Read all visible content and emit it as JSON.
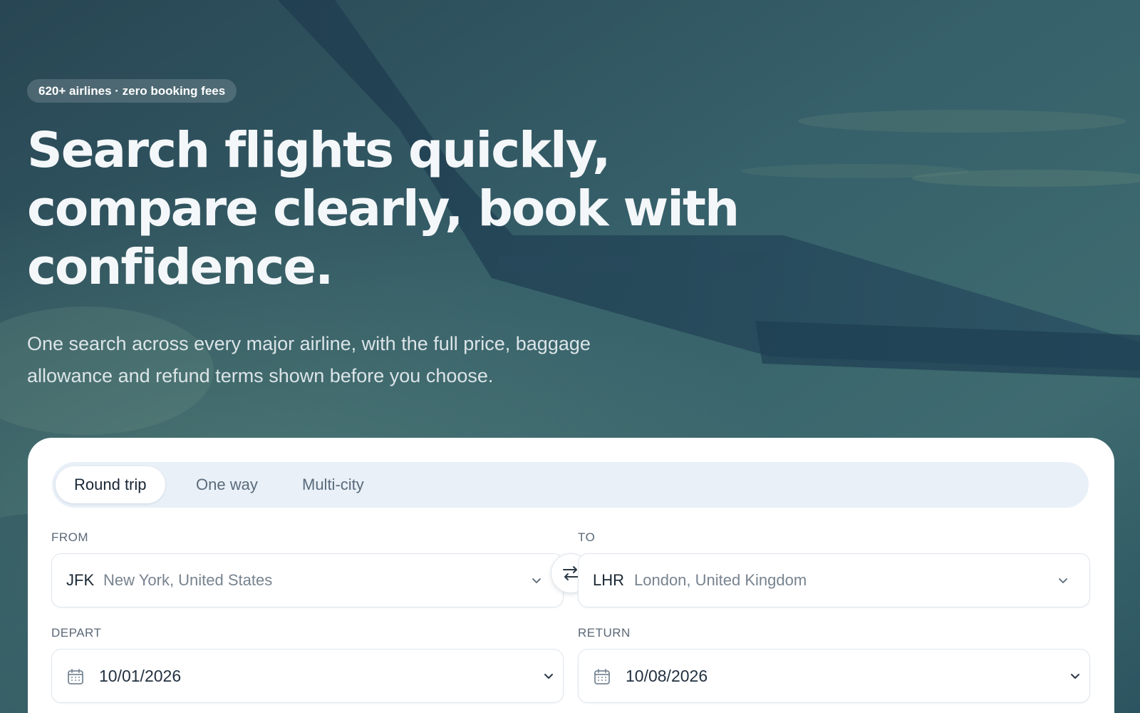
{
  "hero": {
    "badge": "620+ airlines · zero booking fees",
    "headline": "Search flights quickly, compare clearly, book with confidence.",
    "subheadline": "One search across every major airline, with the full price, baggage allowance and refund terms shown before you choose."
  },
  "search": {
    "trip_types": [
      {
        "label": "Round trip",
        "selected": true
      },
      {
        "label": "One way",
        "selected": false
      },
      {
        "label": "Multi-city",
        "selected": false
      }
    ],
    "from": {
      "label": "FROM",
      "code": "JFK",
      "place": "New York, United States"
    },
    "to": {
      "label": "TO",
      "code": "LHR",
      "place": "London, United Kingdom"
    },
    "depart": {
      "label": "DEPART",
      "value": "10/01/2026"
    },
    "return": {
      "label": "RETURN",
      "value": "10/08/2026"
    }
  },
  "icons": {
    "swap": "swap-arrows-icon",
    "calendar": "calendar-icon",
    "dropdown": "chevron-down-icon"
  },
  "colors": {
    "hero_background": "#31525f",
    "card_background": "#ffffff",
    "tabs_background": "#e9f0f8",
    "headline": "#f4f7f9"
  }
}
